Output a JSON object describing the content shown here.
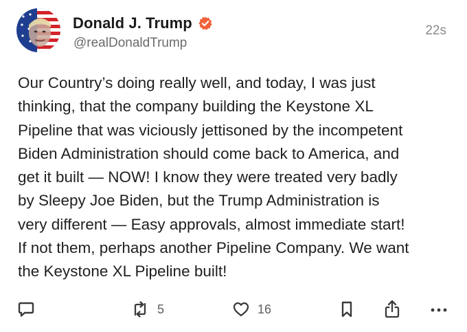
{
  "author": {
    "display_name": "Donald J. Trump",
    "handle": "@realDonaldTrump",
    "verified_icon": "verified-badge-icon",
    "verified_color": "#f0623a"
  },
  "timestamp": "22s",
  "post": {
    "text": "Our Country’s doing really well, and today, I was just\nthinking, that the company building the Keystone XL\nPipeline that was viciously jettisoned by the incompetent\nBiden Administration should come back to America, and\nget it built — NOW! I know they were treated very badly\nby Sleepy Joe Biden, but the Trump Administration is\nvery different — Easy approvals, almost immediate start!\nIf not them, perhaps another Pipeline Company. We want\nthe Keystone XL Pipeline built!"
  },
  "actions": {
    "reply": {
      "icon": "comment-icon"
    },
    "repost": {
      "icon": "repost-icon",
      "count": "5"
    },
    "like": {
      "icon": "heart-icon",
      "count": "16"
    },
    "bookmark": {
      "icon": "bookmark-icon"
    },
    "share": {
      "icon": "share-icon"
    },
    "more": {
      "icon": "more-icon"
    }
  }
}
